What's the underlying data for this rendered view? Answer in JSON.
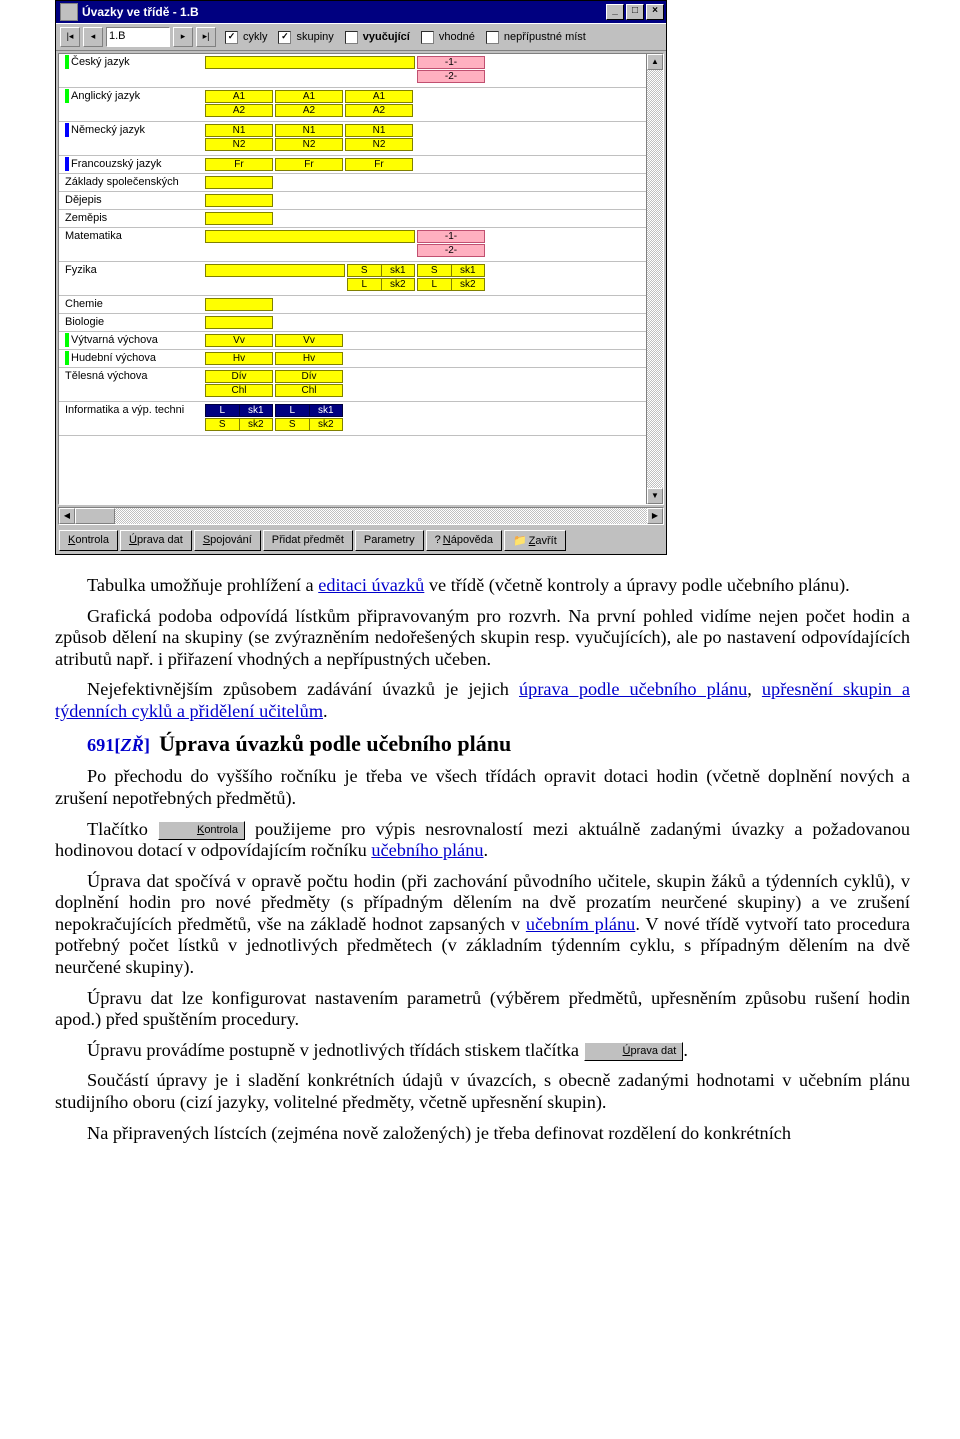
{
  "window": {
    "title": "Úvazky ve třídě - 1.B",
    "class_selected": "1.B",
    "checkboxes": {
      "cykly": {
        "label": "cykly",
        "checked": true
      },
      "skupiny": {
        "label": "skupiny",
        "checked": true
      },
      "vyucujici": {
        "label": "vyučující",
        "checked": false,
        "bold": true
      },
      "vhodne": {
        "label": "vhodné",
        "checked": false
      },
      "nepripustne": {
        "label": "nepřípustné míst",
        "checked": false
      }
    },
    "subjects": [
      {
        "name": "Český jazyk",
        "marker": "green",
        "rows": [
          [
            {
              "w": "w210",
              "v": ""
            },
            {
              "w": "w60",
              "v": "-1-",
              "style": "pink"
            }
          ],
          [
            {
              "w": "w210",
              "v": "",
              "placeholder": true
            },
            {
              "w": "w60",
              "v": "-2-",
              "style": "pink"
            }
          ]
        ]
      },
      {
        "name": "Anglický jazyk",
        "marker": "green",
        "rows": [
          [
            {
              "w": "w60",
              "v": "A1"
            },
            {
              "w": "w60",
              "v": "A1"
            },
            {
              "w": "w60",
              "v": "A1"
            }
          ],
          [
            {
              "w": "w60",
              "v": "A2"
            },
            {
              "w": "w60",
              "v": "A2"
            },
            {
              "w": "w60",
              "v": "A2"
            }
          ]
        ]
      },
      {
        "name": "Německý jazyk",
        "marker": "blue",
        "rows": [
          [
            {
              "w": "w60",
              "v": "N1"
            },
            {
              "w": "w60",
              "v": "N1"
            },
            {
              "w": "w60",
              "v": "N1"
            }
          ],
          [
            {
              "w": "w60",
              "v": "N2"
            },
            {
              "w": "w60",
              "v": "N2"
            },
            {
              "w": "w60",
              "v": "N2"
            }
          ]
        ]
      },
      {
        "name": "Francouzský jazyk",
        "marker": "blue",
        "rows": [
          [
            {
              "w": "w60",
              "v": "Fr"
            },
            {
              "w": "w60",
              "v": "Fr"
            },
            {
              "w": "w60",
              "v": "Fr"
            }
          ]
        ]
      },
      {
        "name": "Základy společenských",
        "rows": [
          [
            {
              "w": "w60",
              "v": ""
            }
          ]
        ]
      },
      {
        "name": "Dějepis",
        "rows": [
          [
            {
              "w": "w60",
              "v": ""
            }
          ]
        ]
      },
      {
        "name": "Zeměpis",
        "rows": [
          [
            {
              "w": "w60",
              "v": ""
            }
          ]
        ]
      },
      {
        "name": "Matematika",
        "rows": [
          [
            {
              "w": "w210",
              "v": ""
            },
            {
              "w": "w60",
              "v": "-1-",
              "style": "pink"
            }
          ],
          [
            {
              "w": "w210",
              "v": "",
              "placeholder": true
            },
            {
              "w": "w60",
              "v": "-2-",
              "style": "pink"
            }
          ]
        ]
      },
      {
        "name": "Fyzika",
        "rows": [
          [
            {
              "w": "w140",
              "v": ""
            },
            {
              "w": "w60",
              "v": "S   sk1",
              "split": [
                "S",
                "sk1"
              ]
            },
            {
              "w": "w60",
              "v": "S   sk1",
              "split": [
                "S",
                "sk1"
              ]
            }
          ],
          [
            {
              "w": "w140",
              "v": "",
              "placeholder": true
            },
            {
              "w": "w60",
              "v": "L   sk2",
              "split": [
                "L",
                "sk2"
              ]
            },
            {
              "w": "w60",
              "v": "L   sk2",
              "split": [
                "L",
                "sk2"
              ]
            }
          ]
        ]
      },
      {
        "name": "Chemie",
        "rows": [
          [
            {
              "w": "w60",
              "v": ""
            }
          ]
        ]
      },
      {
        "name": "Biologie",
        "rows": [
          [
            {
              "w": "w60",
              "v": ""
            }
          ]
        ]
      },
      {
        "name": "Výtvarná výchova",
        "marker": "green",
        "rows": [
          [
            {
              "w": "w60",
              "v": "Vv"
            },
            {
              "w": "w60",
              "v": "Vv"
            }
          ]
        ]
      },
      {
        "name": "Hudební výchova",
        "marker": "green",
        "rows": [
          [
            {
              "w": "w60",
              "v": "Hv"
            },
            {
              "w": "w60",
              "v": "Hv"
            }
          ]
        ]
      },
      {
        "name": "Tělesná výchova",
        "rows": [
          [
            {
              "w": "w60",
              "v": "Dív"
            },
            {
              "w": "w60",
              "v": "Dív"
            }
          ],
          [
            {
              "w": "w60",
              "v": "Chl"
            },
            {
              "w": "w60",
              "v": "Chl"
            }
          ]
        ]
      },
      {
        "name": "Informatika a výp. techni",
        "rows": [
          [
            {
              "w": "w60",
              "style": "dark",
              "split": [
                "L",
                "sk1"
              ]
            },
            {
              "w": "w60",
              "style": "dark",
              "split": [
                "L",
                "sk1"
              ]
            }
          ],
          [
            {
              "w": "w60",
              "split": [
                "S",
                "sk2"
              ]
            },
            {
              "w": "w60",
              "split": [
                "S",
                "sk2"
              ]
            }
          ]
        ]
      }
    ],
    "buttons": {
      "kontrola": "Kontrola",
      "uprava_dat": "Úprava dat",
      "spojovani": "Spojování",
      "pridat_predmet": "Přidat předmět",
      "parametry": "Parametry",
      "napoveda": "Nápověda",
      "zavrit": "Zavřít"
    }
  },
  "doc": {
    "p1a": "Tabulka umožňuje prohlížení a ",
    "p1_link1": "editaci úvazků",
    "p1b": " ve třídě (včetně kontroly a úpravy podle učebního plánu).",
    "p2": "Grafická podoba odpovídá lístkům připravovaným pro rozvrh. Na první pohled vidíme nejen počet hodin a způsob dělení na skupiny (se zvýrazněním nedořešených skupin resp. vyučujících), ale po nastavení odpovídajících atributů např. i přiřazení vhodných a nepřípustných učeben.",
    "p3a": "Nejefektivnějším způsobem zadávání úvazků je jejich ",
    "p3_link1": "úprava podle učebního plánu",
    "p3b": ", ",
    "p3_link2": "upřesnění skupin a týdenních cyklů a přidělení učitelům",
    "p3c": ".",
    "ref_num": "691[",
    "ref_tag": "ZŘ",
    "ref_close": "]",
    "heading": "Úprava úvazků podle učebního plánu",
    "p4": "Po přechodu do vyššího ročníku je třeba ve všech třídách opravit dotaci hodin (včetně doplnění nových a zrušení nepotřebných předmětů).",
    "p5a": "Tlačítko ",
    "p5b": " použijeme pro výpis nesrovnalostí mezi aktuálně zadanými úvazky a požadovanou hodinovou dotací v odpovídajícím ročníku ",
    "p5_link": "učebního plánu",
    "p5c": ".",
    "p6a": "Úprava dat spočívá v opravě počtu hodin (při zachování původního učitele, skupin žáků a týdenních cyklů), v doplnění hodin pro nové předměty (s případným dělením na dvě prozatím neurčené skupiny) a ve zrušení nepokračujících předmětů, vše na základě hodnot zapsaných v ",
    "p6_link": "učebním plánu",
    "p6b": ". V nové třídě vytvoří tato procedura potřebný počet lístků v jednotlivých předmětech (v základním týdenním cyklu, s případným dělením na dvě neurčené skupiny).",
    "p7": "Úpravu dat lze konfigurovat nastavením parametrů (výběrem předmětů, upřesněním způsobu rušení hodin apod.) před spuštěním procedury.",
    "p8a": "Úpravu provádíme postupně v jednotlivých třídách stiskem tlačítka ",
    "p8b": ".",
    "p9": "Součástí úpravy je i sladění konkrétních údajů v úvazcích, s obecně zadanými hodnotami v učebním plánu studijního oboru (cizí jazyky, volitelné předměty, včetně upřesnění skupin).",
    "p10": "Na připravených lístcích (zejména nově založených) je třeba definovat rozdělení do konkrétních"
  }
}
